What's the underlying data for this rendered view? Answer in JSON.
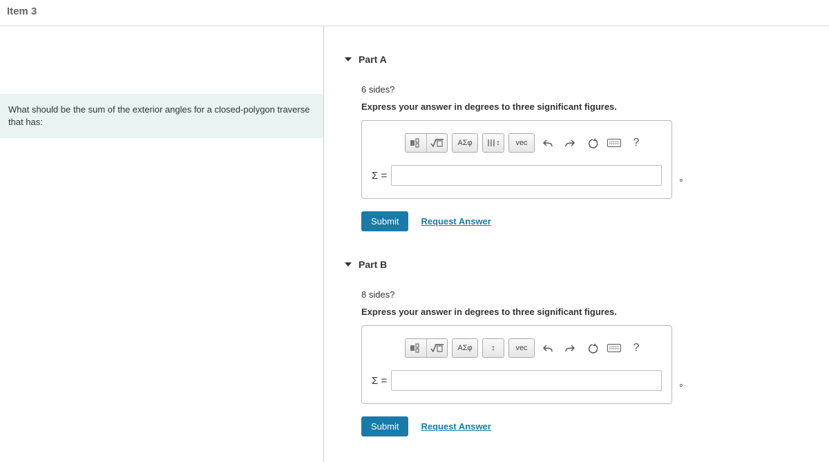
{
  "header": {
    "title": "Item 3"
  },
  "question": {
    "prompt": "What should be the sum of the exterior angles for a closed-polygon traverse that has:"
  },
  "parts": [
    {
      "label": "Part A",
      "subquestion": "6 sides?",
      "instruction": "Express your answer in degrees to three significant figures.",
      "prefix": "Σ =",
      "unit": "∘",
      "submit": "Submit",
      "request": "Request Answer",
      "tools": {
        "greek": "ΑΣφ",
        "vec": "vec",
        "help": "?"
      }
    },
    {
      "label": "Part B",
      "subquestion": "8 sides?",
      "instruction": "Express your answer in degrees to three significant figures.",
      "prefix": "Σ =",
      "unit": "∘",
      "submit": "Submit",
      "request": "Request Answer",
      "tools": {
        "greek": "ΑΣφ",
        "vec": "vec",
        "help": "?"
      }
    }
  ]
}
